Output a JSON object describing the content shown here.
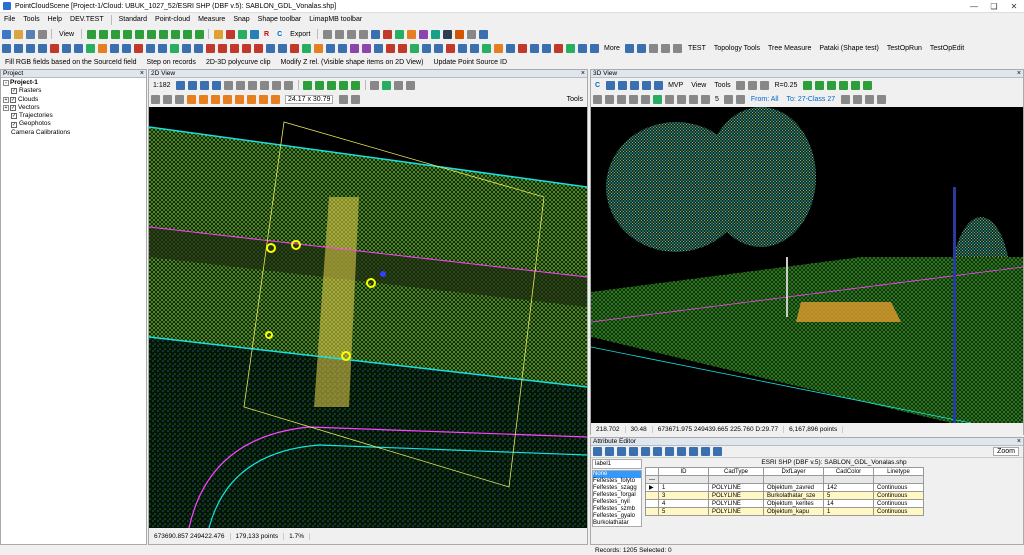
{
  "window": {
    "title": "PointCloudScene [Project-1/Cloud: UBUK_1027_52/ESRI SHP (DBF v.5): SABLON_GDL_Vonalas.shp]"
  },
  "menu": [
    "File",
    "Tools",
    "Help",
    "DEV.TEST",
    "Standard",
    "Point-cloud",
    "Measure",
    "Snap",
    "Shape toolbar",
    "LimapMB toolbar"
  ],
  "toolbar": {
    "view_label": "View",
    "export_label": "Export",
    "r_label": "R",
    "c_label": "C",
    "more_label": "More",
    "test_label": "TEST",
    "topology_label": "Topology Tools",
    "tree_label": "Tree Measure",
    "pataki_label": "Pataki (Shape test)",
    "testoprun_label": "TestOpRun",
    "testopedit_label": "TestOpEdit"
  },
  "commands": [
    "Fill RGB fields based on the SourceId field",
    "Step on records",
    "2D-3D polycurve clip",
    "Modify Z rel. (Visible shape items on 2D View)",
    "Update Point Source ID"
  ],
  "project_panel": {
    "title": "Project",
    "root": "Project-1",
    "items": [
      "Rasters",
      "Clouds",
      "Vectors",
      "Trajectories",
      "Geophotos",
      "Camera Calibrations"
    ]
  },
  "view2d": {
    "title": "2D View",
    "scale": "1:182",
    "size": "24.17 x 30.79",
    "tools_label": "Tools",
    "status": {
      "coords": "673690.857 249422.476",
      "points": "179,133 points",
      "zoom": "1.7%"
    }
  },
  "view3d": {
    "title": "3D View",
    "mvp": "MVP",
    "view_label": "View",
    "tools_label": "Tools",
    "radius": "R=0.25",
    "count": "5",
    "from": "From: All",
    "to": "To: 27-Class 27",
    "status": {
      "a": "218.702",
      "b": "30.48",
      "coords": "673671.975 249439.665 225.760 D:29.77",
      "points": "6,167,896 points"
    }
  },
  "attr": {
    "title": "Attribute Editor",
    "zoom": "Zoom",
    "layer_title": "ESRI SHP (DBF v.5): SABLON_GDL_Vonalas.shp",
    "combo": "label1",
    "list": [
      "None",
      "Felfestes_folyto",
      "Felfestes_szagg",
      "Felfestes_forgal",
      "Felfestes_nyil",
      "Felfestes_szmb",
      "Felfestes_gyalo",
      "Burkolathatar"
    ],
    "columns": [
      "ID",
      "CadType",
      "DxfLayer",
      "CadColor",
      "Linetype"
    ],
    "rows": [
      {
        "id": "1",
        "type": "POLYLINE",
        "layer": "Objektum_zavred",
        "color": "142",
        "lt": "Continuous"
      },
      {
        "id": "3",
        "type": "POLYLINE",
        "layer": "Burkolathatar_sze",
        "color": "5",
        "lt": "Continuous"
      },
      {
        "id": "4",
        "type": "POLYLINE",
        "layer": "Objektum_kerites",
        "color": "14",
        "lt": "Continuous"
      },
      {
        "id": "5",
        "type": "POLYLINE",
        "layer": "Objektum_kapu",
        "color": "1",
        "lt": "Continuous"
      }
    ],
    "records": "Records:  1205  Selected:  0"
  },
  "colors": {
    "accent": "#2a6fd1",
    "selection": "#fff8c4",
    "list_sel": "#3399ff"
  }
}
